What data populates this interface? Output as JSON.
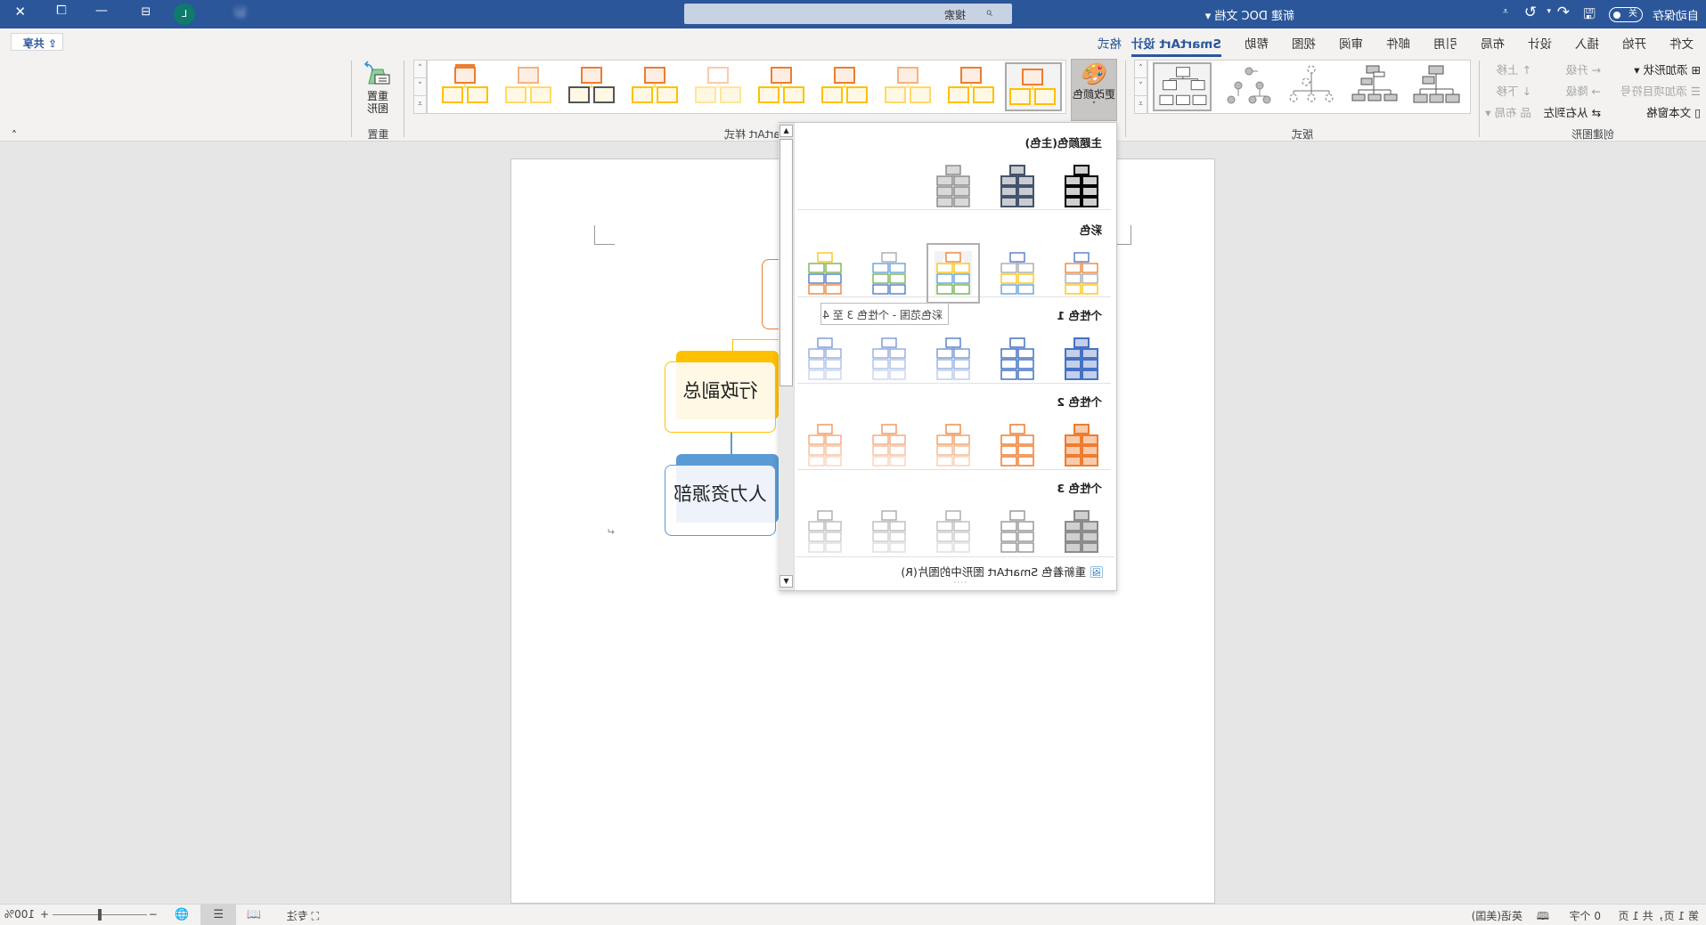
{
  "titlebar": {
    "autosave_label": "自动保存",
    "autosave_state": "关",
    "doc_title": "新建 DOC 文档 ▾",
    "search_placeholder": "搜索",
    "user_initial": "L",
    "user_name": "Li",
    "color": "#2b579a"
  },
  "tabs": [
    {
      "label": "文件"
    },
    {
      "label": "开始"
    },
    {
      "label": "插入"
    },
    {
      "label": "设计"
    },
    {
      "label": "布局"
    },
    {
      "label": "引用"
    },
    {
      "label": "邮件"
    },
    {
      "label": "审阅"
    },
    {
      "label": "视图"
    },
    {
      "label": "帮助"
    },
    {
      "label": "SmartArt 设计",
      "active": true
    },
    {
      "label": "格式"
    }
  ],
  "share_label": "共享",
  "ribbon": {
    "create_graphic": {
      "label": "创建图形",
      "add_shape": "添加形状",
      "add_bullet": "添加项目符号",
      "text_pane": "文本窗格",
      "promote": "升级",
      "demote": "降级",
      "right_to_left": "从右到左",
      "move_up": "上移",
      "move_down": "下移",
      "layout": "布局"
    },
    "layouts": {
      "label": "版式"
    },
    "change_colors": "更改颜色",
    "smartart_styles": {
      "label": "SmartArt 样式",
      "items": [
        {
          "top": "#ed7d31",
          "bottom": "#ffc000",
          "kind": "3d"
        },
        {
          "top": "#f4b183",
          "bottom": "#ffd966",
          "kind": "flat"
        },
        {
          "top": "#ed7d31",
          "bottom": "#ffc000",
          "kind": "outline"
        },
        {
          "top": "#ed7d31",
          "bottom": "#ffc000",
          "kind": "shadow"
        },
        {
          "top": "#f8cbad",
          "bottom": "#ffe699",
          "kind": "soft"
        },
        {
          "top": "#ed7d31",
          "bottom": "#ffc000",
          "kind": "flat"
        },
        {
          "top": "#ed7d31",
          "bottom": "#ffc000",
          "kind": "flat"
        },
        {
          "top": "#f4b183",
          "bottom": "#ffd966",
          "kind": "flat"
        },
        {
          "top": "#ed7d31",
          "bottom": "#ffc000",
          "kind": "flat"
        },
        {
          "top": "#ed7d31",
          "bottom": "#ffc000",
          "kind": "selected"
        }
      ]
    },
    "reset": {
      "button": "重置图形",
      "label": "重置"
    }
  },
  "color_menu": {
    "sections": [
      {
        "title": "主题颜色(主色)",
        "items": [
          {
            "stroke": [
              "#000000"
            ],
            "fill": "#d0d0d0",
            "w": 2
          },
          {
            "stroke": [
              "#44546a"
            ],
            "fill": "#c9ccd1",
            "w": 2
          },
          {
            "stroke": [
              "#7f7f7f"
            ],
            "fill": "#d9d9d9",
            "w": 1.3
          }
        ]
      },
      {
        "title": "彩色",
        "items": [
          {
            "stroke": [
              "#4472c4",
              "#ed7d31",
              "#a5a5a5",
              "#ffc000"
            ],
            "fill": "#ffffff",
            "w": 1.3
          },
          {
            "stroke": [
              "#4472c4",
              "#a5a5a5",
              "#ffc000",
              "#5b9bd5"
            ],
            "fill": "#ffffff",
            "w": 1.3
          },
          {
            "stroke": [
              "#ed7d31",
              "#ffc000",
              "#5b9bd5",
              "#70ad47"
            ],
            "fill": "#ffffff",
            "w": 1.3,
            "selected": true
          },
          {
            "stroke": [
              "#a5a5a5",
              "#5b9bd5",
              "#70ad47",
              "#4472c4"
            ],
            "fill": "#ffffff",
            "w": 1.3
          },
          {
            "stroke": [
              "#ffc000",
              "#70ad47",
              "#4472c4",
              "#ed7d31"
            ],
            "fill": "#ffffff",
            "w": 1.3
          }
        ]
      },
      {
        "title": "个性色 1",
        "items": [
          {
            "stroke": [
              "#4472c4"
            ],
            "fill": "#c5cfe9",
            "w": 2
          },
          {
            "stroke": [
              "#4472c4"
            ],
            "fill": "#ffffff",
            "w": 1.5
          },
          {
            "stroke": [
              "#4472c4"
            ],
            "fill": "#ffffff",
            "w": 1.3,
            "fade": true
          },
          {
            "stroke": [
              "#6f8fd6"
            ],
            "fill": "#ffffff",
            "w": 1.3,
            "fade": true
          },
          {
            "stroke": [
              "#6f8fd6"
            ],
            "fill": "#ffffff",
            "w": 1.3,
            "fade": true
          }
        ]
      },
      {
        "title": "个性色 2",
        "items": [
          {
            "stroke": [
              "#ed7d31"
            ],
            "fill": "#f8cbad",
            "w": 2
          },
          {
            "stroke": [
              "#ed7d31"
            ],
            "fill": "#ffffff",
            "w": 1.5
          },
          {
            "stroke": [
              "#ed7d31"
            ],
            "fill": "#ffffff",
            "w": 1.3,
            "fade": true
          },
          {
            "stroke": [
              "#f08c4e"
            ],
            "fill": "#ffffff",
            "w": 1.3,
            "fade": true
          },
          {
            "stroke": [
              "#f08c4e"
            ],
            "fill": "#ffffff",
            "w": 1.3,
            "fade": true
          }
        ]
      },
      {
        "title": "个性色 3",
        "items": [
          {
            "stroke": [
              "#8c8c8c"
            ],
            "fill": "#d0d0d0",
            "w": 2
          },
          {
            "stroke": [
              "#8c8c8c"
            ],
            "fill": "#ffffff",
            "w": 1.3
          },
          {
            "stroke": [
              "#a5a5a5"
            ],
            "fill": "#ffffff",
            "w": 1.3,
            "fade": true
          },
          {
            "stroke": [
              "#a5a5a5"
            ],
            "fill": "#ffffff",
            "w": 1.3,
            "fade": true
          },
          {
            "stroke": [
              "#a5a5a5"
            ],
            "fill": "#ffffff",
            "w": 1.3,
            "fade": true
          }
        ]
      }
    ],
    "tooltip": "彩色范围 - 个性色 3 至 4",
    "recolor_pictures": "重新着色 SmartArt 图形中的图片(R)"
  },
  "smartart": {
    "node1": "行政副总",
    "node2": "人力资源部",
    "colors": {
      "top": "#ed7d31",
      "node1": "#ffc000",
      "node1_fill": "#fff8e5",
      "node2": "#5b9bd5",
      "node2_fill": "#eef3fb"
    }
  },
  "statusbar": {
    "page": "第 1 页，共 1 页",
    "words": "0 个字",
    "language": "英语(美国)",
    "focus": "专注",
    "zoom": "100%",
    "zoom_level": 100
  }
}
